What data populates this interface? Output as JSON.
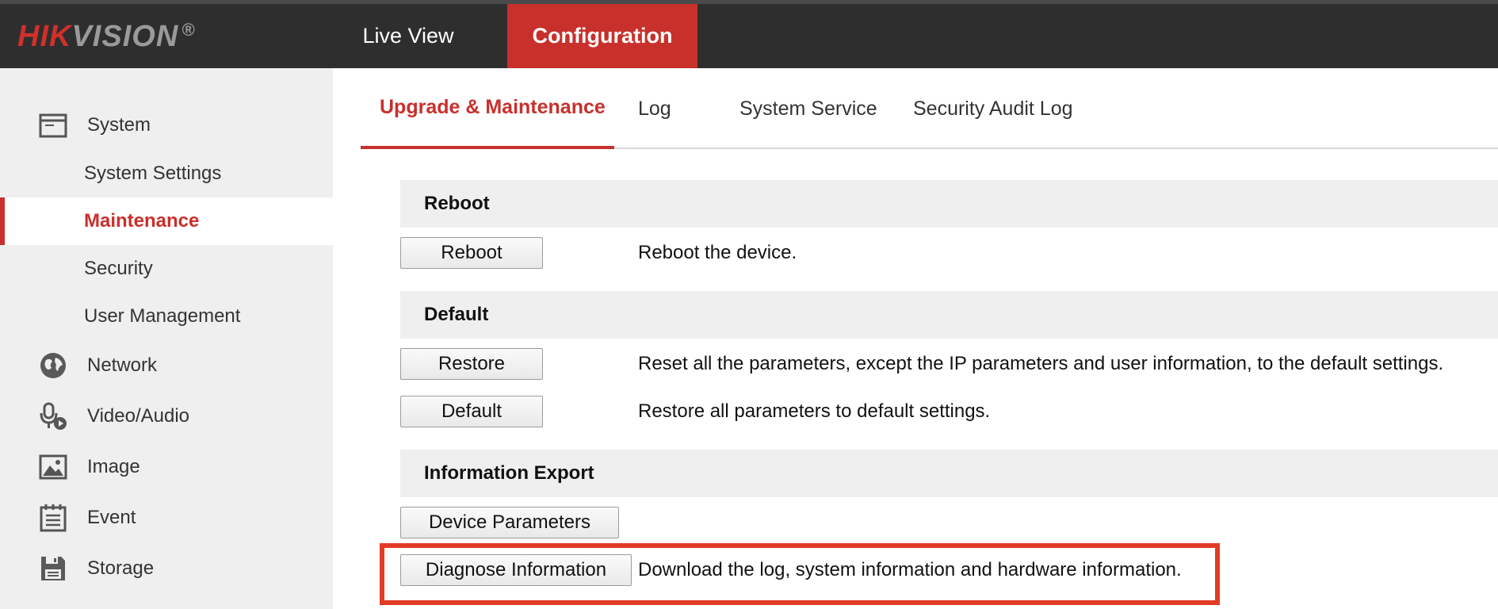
{
  "header": {
    "logo": {
      "hik": "HIK",
      "vision": "VISION",
      "reg": "®"
    },
    "nav": {
      "live_view": "Live View",
      "configuration": "Configuration"
    }
  },
  "sidebar": {
    "items": [
      {
        "label": "System",
        "icon": "window-icon",
        "level": "main"
      },
      {
        "label": "System Settings",
        "level": "sub"
      },
      {
        "label": "Maintenance",
        "level": "sub",
        "active": true
      },
      {
        "label": "Security",
        "level": "sub"
      },
      {
        "label": "User Management",
        "level": "sub"
      },
      {
        "label": "Network",
        "icon": "globe-icon",
        "level": "main"
      },
      {
        "label": "Video/Audio",
        "icon": "microphone-icon",
        "level": "main"
      },
      {
        "label": "Image",
        "icon": "image-icon",
        "level": "main"
      },
      {
        "label": "Event",
        "icon": "calendar-icon",
        "level": "main"
      },
      {
        "label": "Storage",
        "icon": "floppy-disk-icon",
        "level": "main"
      }
    ]
  },
  "tabs": [
    {
      "label": "Upgrade & Maintenance",
      "active": true
    },
    {
      "label": "Log"
    },
    {
      "label": "System Service"
    },
    {
      "label": "Security Audit Log"
    }
  ],
  "sections": {
    "reboot": {
      "title": "Reboot",
      "button": "Reboot",
      "desc": "Reboot the device."
    },
    "default": {
      "title": "Default",
      "restore_button": "Restore",
      "restore_desc": "Reset all the parameters, except the IP parameters and user information, to the default settings.",
      "default_button": "Default",
      "default_desc": "Restore all parameters to default settings."
    },
    "export": {
      "title": "Information Export",
      "device_params_button": "Device Parameters",
      "diagnose_button": "Diagnose Information",
      "diagnose_desc": "Download the log, system information and hardware information."
    }
  },
  "colors": {
    "accent": "#c8302c",
    "topbar": "#2e2e2e",
    "sidebar_bg": "#efefef",
    "highlight": "#e23b25"
  }
}
